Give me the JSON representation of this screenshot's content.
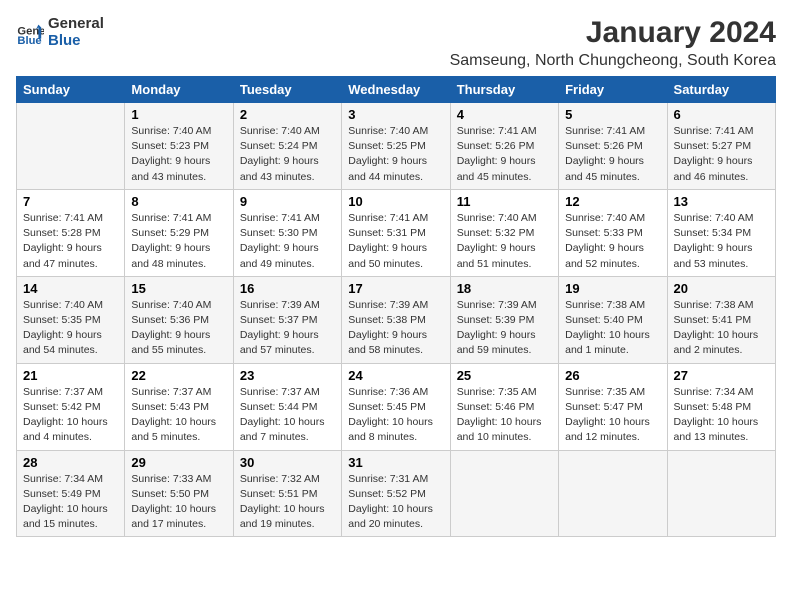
{
  "logo": {
    "line1": "General",
    "line2": "Blue"
  },
  "title": "January 2024",
  "subtitle": "Samseung, North Chungcheong, South Korea",
  "days_of_week": [
    "Sunday",
    "Monday",
    "Tuesday",
    "Wednesday",
    "Thursday",
    "Friday",
    "Saturday"
  ],
  "weeks": [
    [
      {
        "day": "",
        "info": ""
      },
      {
        "day": "1",
        "info": "Sunrise: 7:40 AM\nSunset: 5:23 PM\nDaylight: 9 hours\nand 43 minutes."
      },
      {
        "day": "2",
        "info": "Sunrise: 7:40 AM\nSunset: 5:24 PM\nDaylight: 9 hours\nand 43 minutes."
      },
      {
        "day": "3",
        "info": "Sunrise: 7:40 AM\nSunset: 5:25 PM\nDaylight: 9 hours\nand 44 minutes."
      },
      {
        "day": "4",
        "info": "Sunrise: 7:41 AM\nSunset: 5:26 PM\nDaylight: 9 hours\nand 45 minutes."
      },
      {
        "day": "5",
        "info": "Sunrise: 7:41 AM\nSunset: 5:26 PM\nDaylight: 9 hours\nand 45 minutes."
      },
      {
        "day": "6",
        "info": "Sunrise: 7:41 AM\nSunset: 5:27 PM\nDaylight: 9 hours\nand 46 minutes."
      }
    ],
    [
      {
        "day": "7",
        "info": "Sunrise: 7:41 AM\nSunset: 5:28 PM\nDaylight: 9 hours\nand 47 minutes."
      },
      {
        "day": "8",
        "info": "Sunrise: 7:41 AM\nSunset: 5:29 PM\nDaylight: 9 hours\nand 48 minutes."
      },
      {
        "day": "9",
        "info": "Sunrise: 7:41 AM\nSunset: 5:30 PM\nDaylight: 9 hours\nand 49 minutes."
      },
      {
        "day": "10",
        "info": "Sunrise: 7:41 AM\nSunset: 5:31 PM\nDaylight: 9 hours\nand 50 minutes."
      },
      {
        "day": "11",
        "info": "Sunrise: 7:40 AM\nSunset: 5:32 PM\nDaylight: 9 hours\nand 51 minutes."
      },
      {
        "day": "12",
        "info": "Sunrise: 7:40 AM\nSunset: 5:33 PM\nDaylight: 9 hours\nand 52 minutes."
      },
      {
        "day": "13",
        "info": "Sunrise: 7:40 AM\nSunset: 5:34 PM\nDaylight: 9 hours\nand 53 minutes."
      }
    ],
    [
      {
        "day": "14",
        "info": "Sunrise: 7:40 AM\nSunset: 5:35 PM\nDaylight: 9 hours\nand 54 minutes."
      },
      {
        "day": "15",
        "info": "Sunrise: 7:40 AM\nSunset: 5:36 PM\nDaylight: 9 hours\nand 55 minutes."
      },
      {
        "day": "16",
        "info": "Sunrise: 7:39 AM\nSunset: 5:37 PM\nDaylight: 9 hours\nand 57 minutes."
      },
      {
        "day": "17",
        "info": "Sunrise: 7:39 AM\nSunset: 5:38 PM\nDaylight: 9 hours\nand 58 minutes."
      },
      {
        "day": "18",
        "info": "Sunrise: 7:39 AM\nSunset: 5:39 PM\nDaylight: 9 hours\nand 59 minutes."
      },
      {
        "day": "19",
        "info": "Sunrise: 7:38 AM\nSunset: 5:40 PM\nDaylight: 10 hours\nand 1 minute."
      },
      {
        "day": "20",
        "info": "Sunrise: 7:38 AM\nSunset: 5:41 PM\nDaylight: 10 hours\nand 2 minutes."
      }
    ],
    [
      {
        "day": "21",
        "info": "Sunrise: 7:37 AM\nSunset: 5:42 PM\nDaylight: 10 hours\nand 4 minutes."
      },
      {
        "day": "22",
        "info": "Sunrise: 7:37 AM\nSunset: 5:43 PM\nDaylight: 10 hours\nand 5 minutes."
      },
      {
        "day": "23",
        "info": "Sunrise: 7:37 AM\nSunset: 5:44 PM\nDaylight: 10 hours\nand 7 minutes."
      },
      {
        "day": "24",
        "info": "Sunrise: 7:36 AM\nSunset: 5:45 PM\nDaylight: 10 hours\nand 8 minutes."
      },
      {
        "day": "25",
        "info": "Sunrise: 7:35 AM\nSunset: 5:46 PM\nDaylight: 10 hours\nand 10 minutes."
      },
      {
        "day": "26",
        "info": "Sunrise: 7:35 AM\nSunset: 5:47 PM\nDaylight: 10 hours\nand 12 minutes."
      },
      {
        "day": "27",
        "info": "Sunrise: 7:34 AM\nSunset: 5:48 PM\nDaylight: 10 hours\nand 13 minutes."
      }
    ],
    [
      {
        "day": "28",
        "info": "Sunrise: 7:34 AM\nSunset: 5:49 PM\nDaylight: 10 hours\nand 15 minutes."
      },
      {
        "day": "29",
        "info": "Sunrise: 7:33 AM\nSunset: 5:50 PM\nDaylight: 10 hours\nand 17 minutes."
      },
      {
        "day": "30",
        "info": "Sunrise: 7:32 AM\nSunset: 5:51 PM\nDaylight: 10 hours\nand 19 minutes."
      },
      {
        "day": "31",
        "info": "Sunrise: 7:31 AM\nSunset: 5:52 PM\nDaylight: 10 hours\nand 20 minutes."
      },
      {
        "day": "",
        "info": ""
      },
      {
        "day": "",
        "info": ""
      },
      {
        "day": "",
        "info": ""
      }
    ]
  ]
}
